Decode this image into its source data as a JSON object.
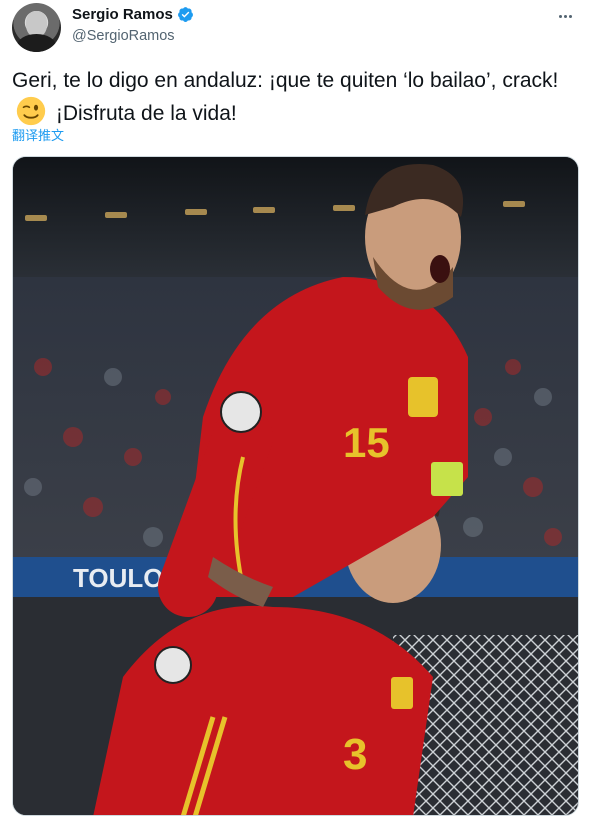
{
  "author": {
    "display_name": "Sergio Ramos",
    "handle": "@SergioRamos",
    "verified": true,
    "avatar_icon": "avatar-photo"
  },
  "tweet": {
    "text_part1": "Geri, te lo digo en andaluz: ¡que te quiten ‘lo bailao’, crack!",
    "emoji": "winking-face-emoji",
    "text_part2": "¡Disfruta de la vida!",
    "translate_label": "翻译推文"
  },
  "media": {
    "stadium_banner_text": "TOULOU",
    "jersey_number_top": "15",
    "jersey_number_bottom": "3"
  },
  "colors": {
    "accent": "#1d9bf0",
    "text": "#0f1419",
    "secondary": "#536471",
    "jersey_red": "#c4161c"
  }
}
